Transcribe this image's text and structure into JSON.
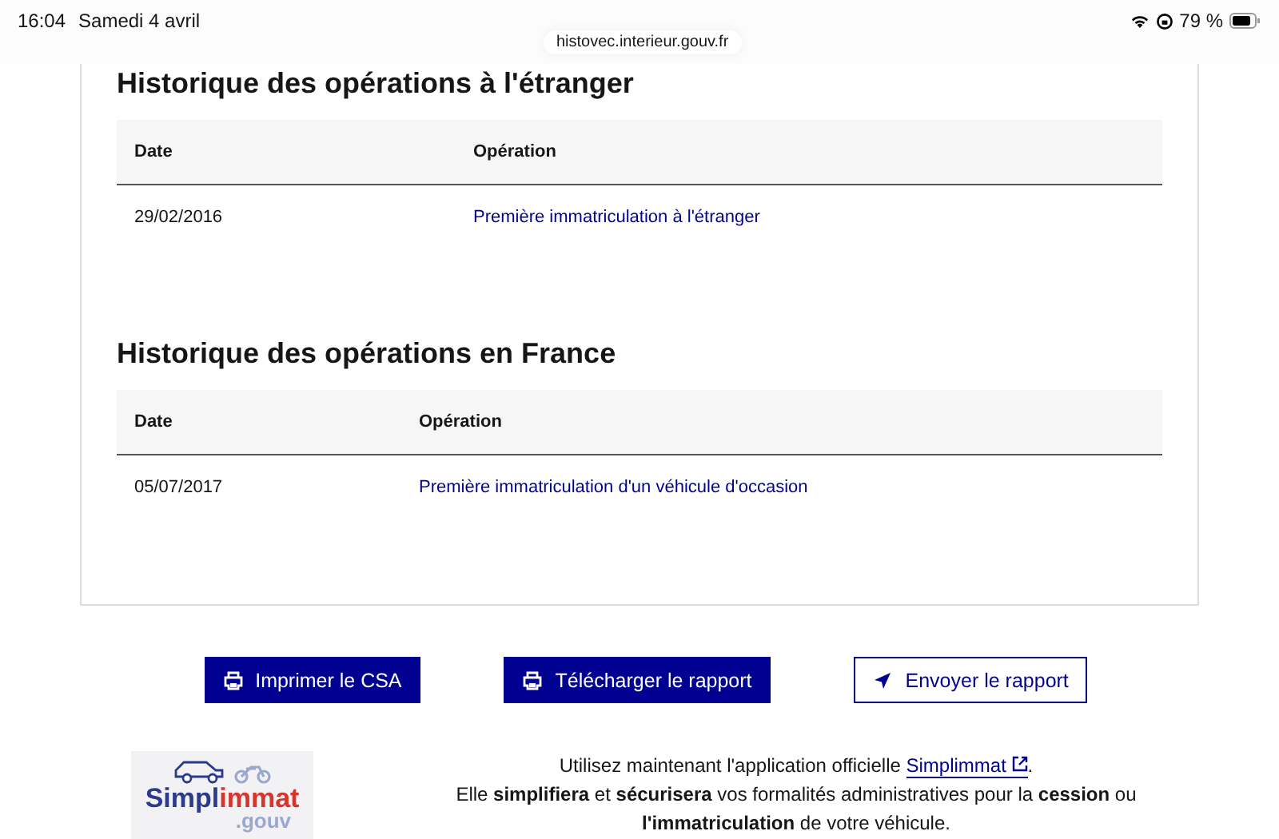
{
  "status_bar": {
    "time": "16:04",
    "date": "Samedi 4 avril",
    "url": "histovec.interieur.gouv.fr",
    "battery_percent": "79 %"
  },
  "sections": [
    {
      "title": "Historique des opérations à l'étranger",
      "columns": [
        "Date",
        "Opération"
      ],
      "rows": [
        {
          "date": "29/02/2016",
          "operation": "Première immatriculation à l'étranger"
        }
      ]
    },
    {
      "title": "Historique des opérations en France",
      "columns": [
        "Date",
        "Opération"
      ],
      "rows": [
        {
          "date": "05/07/2017",
          "operation": "Première immatriculation d'un véhicule d'occasion"
        }
      ]
    }
  ],
  "actions": [
    {
      "label": "Imprimer le CSA",
      "kind": "print"
    },
    {
      "label": "Télécharger le rapport",
      "kind": "print"
    },
    {
      "label": "Envoyer le rapport",
      "kind": "send"
    }
  ],
  "promo": {
    "logo": {
      "part_1": "Simpl",
      "part_2": "immat",
      "part_3": ".gouv"
    },
    "intro_before": "Utilisez maintenant l'application officielle ",
    "link": "Simplimmat",
    "intro_after": ".",
    "body": "Elle **simplifiera** et **sécurisera** vos formalités administratives pour la **cession** ou **l'immatriculation** de votre véhicule."
  }
}
